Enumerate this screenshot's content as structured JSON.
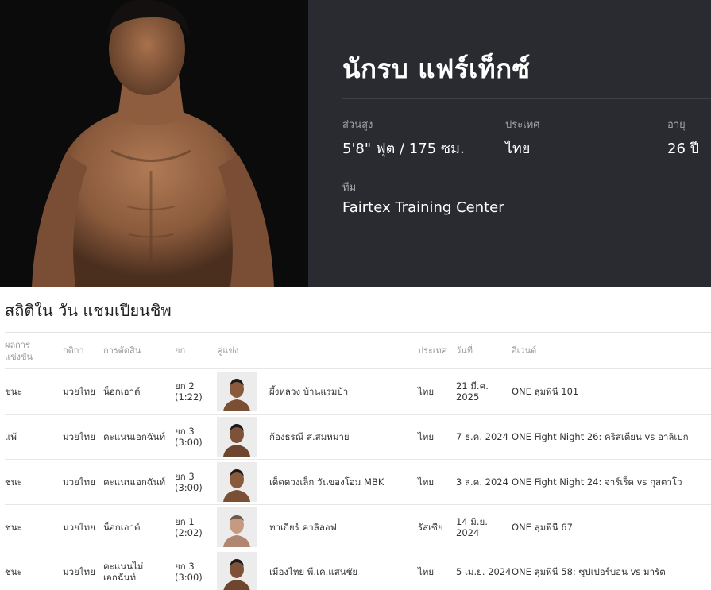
{
  "fighter": {
    "name": "นักรบ แฟร์เท็กซ์",
    "height_label": "ส่วนสูง",
    "height_value": "5'8\" ฟุต / 175 ซม.",
    "country_label": "ประเทศ",
    "country_value": "ไทย",
    "age_label": "อายุ",
    "age_value": "26 ปี",
    "team_label": "ทีม",
    "team_value": "Fairtex Training Center"
  },
  "stats": {
    "title": "สถิติใน วัน แชมเปียนชิพ",
    "columns": {
      "result": "ผลการแข่งขัน",
      "rules": "กติกา",
      "method": "การตัดสิน",
      "round": "ยก",
      "opponent": "คู่แข่ง",
      "country": "ประเทศ",
      "date": "วันที่",
      "event": "อีเวนต์"
    },
    "rows": [
      {
        "result": "ชนะ",
        "rules": "มวยไทย",
        "method": "น็อกเอาต์",
        "round": "ยก 2",
        "time": "(1:22)",
        "opponent": "ผึ้งหลวง บ้านแรมบ้า",
        "country": "ไทย",
        "date": "21 มี.ค. 2025",
        "event": "ONE ลุมพินี 101"
      },
      {
        "result": "แพ้",
        "rules": "มวยไทย",
        "method": "คะแนนเอกฉันท์",
        "round": "ยก 3",
        "time": "(3:00)",
        "opponent": "ก้องธรณี ส.สมหมาย",
        "country": "ไทย",
        "date": "7 ธ.ค. 2024",
        "event": "ONE Fight Night 26: คริสเตียน vs อาลิเบก"
      },
      {
        "result": "ชนะ",
        "rules": "มวยไทย",
        "method": "คะแนนเอกฉันท์",
        "round": "ยก 3",
        "time": "(3:00)",
        "opponent": "เด็ดดวงเล็ก วันของโอม MBK",
        "country": "ไทย",
        "date": "3 ส.ค. 2024",
        "event": "ONE Fight Night 24: จาร์เร็ด vs กุสตาโว"
      },
      {
        "result": "ชนะ",
        "rules": "มวยไทย",
        "method": "น็อกเอาต์",
        "round": "ยก 1",
        "time": "(2:02)",
        "opponent": "ทาเกียร์ คาลิลอฟ",
        "country": "รัสเซีย",
        "date": "14 มิ.ย. 2024",
        "event": "ONE ลุมพินี 67"
      },
      {
        "result": "ชนะ",
        "rules": "มวยไทย",
        "method": "คะแนนไม่เอกฉันท์",
        "round": "ยก 3",
        "time": "(3:00)",
        "opponent": "เมืองไทย พี.เค.แสนชัย",
        "country": "ไทย",
        "date": "5 เม.ย. 2024",
        "event": "ONE ลุมพินี 58: ซุปเปอร์บอน vs มารัต"
      }
    ]
  }
}
